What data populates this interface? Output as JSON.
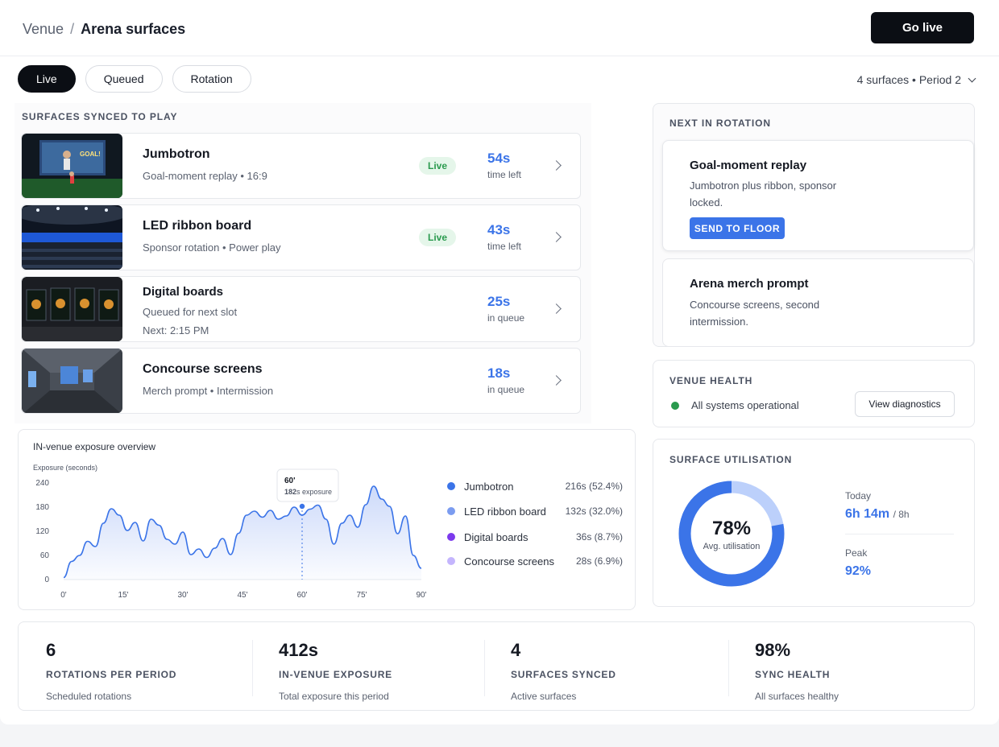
{
  "header": {
    "breadcrumb_root": "Venue",
    "breadcrumb_separator": "/",
    "breadcrumb_current": "Arena surfaces",
    "go_live_label": "Go live"
  },
  "tabs": [
    {
      "label": "Live",
      "active": true
    },
    {
      "label": "Queued",
      "active": false
    },
    {
      "label": "Rotation",
      "active": false
    }
  ],
  "period_selector": "4 surfaces • Period 2",
  "surfaces_section_label": "SURFACES SYNCED TO PLAY",
  "surfaces": [
    {
      "title": "Jumbotron",
      "subtitle": "Goal-moment replay • 16:9",
      "subtitle2": "",
      "badge": "Live",
      "value": "54s",
      "value_label": "time left",
      "thumbnail": "stadium-jumbotron"
    },
    {
      "title": "LED ribbon board",
      "subtitle": "Sponsor rotation  •  Power play",
      "subtitle2": "",
      "badge": "Live",
      "value": "43s",
      "value_label": "time left",
      "thumbnail": "arena-led-ribbon"
    },
    {
      "title": "Digital boards",
      "subtitle": "Queued for next slot",
      "subtitle2": "Next: 2:15 PM",
      "badge": "",
      "value": "25s",
      "value_label": "in queue",
      "thumbnail": "menu-boards"
    },
    {
      "title": "Concourse screens",
      "subtitle": "Merch prompt  •  Intermission",
      "subtitle2": "",
      "badge": "",
      "value": "18s",
      "value_label": "in queue",
      "thumbnail": "concourse-hall"
    }
  ],
  "rotation": {
    "section_label": "NEXT IN ROTATION",
    "items": [
      {
        "title": "Goal-moment replay",
        "description": "Jumbotron plus ribbon, sponsor locked.",
        "button": "SEND TO FLOOR"
      },
      {
        "title": "Arena merch prompt",
        "description": "Concourse screens, second intermission."
      }
    ]
  },
  "health": {
    "section_label": "VENUE HEALTH",
    "status": "All systems operational",
    "status_color": "#2a9a4e",
    "button": "View diagnostics"
  },
  "exposure_chart": {
    "title": "IN-venue exposure overview",
    "ylabel": "Exposure (seconds)",
    "tooltip_minute": "60'",
    "tooltip_value": "182",
    "tooltip_suffix": "s exposure",
    "legend": [
      {
        "name": "Jumbotron",
        "value": "216s (52.4%)",
        "color": "#3b74e8"
      },
      {
        "name": "LED ribbon board",
        "value": "132s (32.0%)",
        "color": "#7b9cf0"
      },
      {
        "name": "Digital boards",
        "value": "36s (8.7%)",
        "color": "#7c3aed"
      },
      {
        "name": "Concourse screens",
        "value": "28s (6.9%)",
        "color": "#c4b5fd"
      }
    ]
  },
  "chart_data": {
    "type": "area",
    "title": "IN-venue exposure overview",
    "xlabel": "",
    "ylabel": "Exposure (seconds)",
    "xlim": [
      0,
      90
    ],
    "ylim": [
      0,
      240
    ],
    "x_ticks": [
      "0'",
      "15'",
      "30'",
      "45'",
      "60'",
      "75'",
      "90'"
    ],
    "y_ticks": [
      "0",
      "60",
      "120",
      "180",
      "240"
    ],
    "grid": false,
    "x": [
      0,
      2,
      4,
      6,
      8,
      10,
      12,
      14,
      16,
      18,
      20,
      22,
      24,
      26,
      28,
      30,
      32,
      34,
      36,
      38,
      40,
      42,
      44,
      46,
      48,
      50,
      52,
      54,
      56,
      58,
      60,
      62,
      64,
      66,
      68,
      70,
      72,
      74,
      76,
      78,
      80,
      82,
      84,
      86,
      88,
      90
    ],
    "series": [
      {
        "values": [
          5,
          45,
          60,
          95,
          82,
          140,
          176,
          160,
          122,
          142,
          96,
          150,
          135,
          100,
          88,
          118,
          62,
          76,
          55,
          78,
          102,
          62,
          115,
          160,
          170,
          155,
          172,
          150,
          158,
          180,
          160,
          175,
          185,
          150,
          88,
          140,
          160,
          130,
          186,
          232,
          200,
          182,
          114,
          158,
          60,
          28
        ]
      }
    ]
  },
  "utilisation": {
    "section_label": "SURFACE UTILISATION",
    "percent": 78,
    "percent_label": "78%",
    "caption": "Avg. utilisation",
    "today_label": "Today",
    "today_value": "6h 14m",
    "today_total": "/ 8h",
    "peak_label": "Peak",
    "peak_value": "92%",
    "ring_color": "#3b74e8",
    "ring_secondary_color": "#bcd0fb"
  },
  "kpis": [
    {
      "number": "6",
      "title": "ROTATIONS PER PERIOD",
      "desc": "Scheduled rotations"
    },
    {
      "number": "412s",
      "title": "IN-VENUE EXPOSURE",
      "desc": "Total exposure this period"
    },
    {
      "number": "4",
      "title": "SURFACES SYNCED",
      "desc": "Active surfaces"
    },
    {
      "number": "98%",
      "title": "SYNC HEALTH",
      "desc": "All surfaces healthy"
    }
  ]
}
